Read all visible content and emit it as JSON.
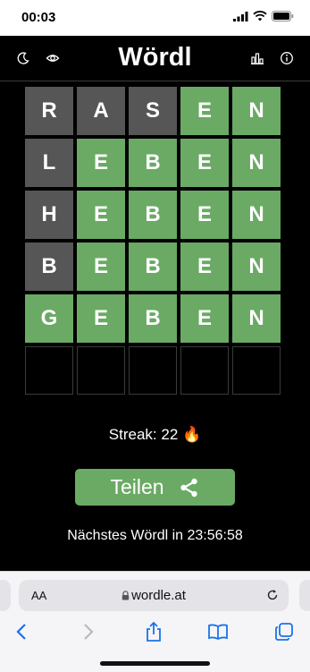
{
  "status_bar": {
    "time": "00:03"
  },
  "header": {
    "title": "Wördl"
  },
  "board": {
    "rows": [
      [
        {
          "letter": "R",
          "state": "absent"
        },
        {
          "letter": "A",
          "state": "absent"
        },
        {
          "letter": "S",
          "state": "absent"
        },
        {
          "letter": "E",
          "state": "correct"
        },
        {
          "letter": "N",
          "state": "correct"
        }
      ],
      [
        {
          "letter": "L",
          "state": "absent"
        },
        {
          "letter": "E",
          "state": "correct"
        },
        {
          "letter": "B",
          "state": "correct"
        },
        {
          "letter": "E",
          "state": "correct"
        },
        {
          "letter": "N",
          "state": "correct"
        }
      ],
      [
        {
          "letter": "H",
          "state": "absent"
        },
        {
          "letter": "E",
          "state": "correct"
        },
        {
          "letter": "B",
          "state": "correct"
        },
        {
          "letter": "E",
          "state": "correct"
        },
        {
          "letter": "N",
          "state": "correct"
        }
      ],
      [
        {
          "letter": "B",
          "state": "absent"
        },
        {
          "letter": "E",
          "state": "correct"
        },
        {
          "letter": "B",
          "state": "correct"
        },
        {
          "letter": "E",
          "state": "correct"
        },
        {
          "letter": "N",
          "state": "correct"
        }
      ],
      [
        {
          "letter": "G",
          "state": "correct"
        },
        {
          "letter": "E",
          "state": "correct"
        },
        {
          "letter": "B",
          "state": "correct"
        },
        {
          "letter": "E",
          "state": "correct"
        },
        {
          "letter": "N",
          "state": "correct"
        }
      ],
      [
        {
          "letter": "",
          "state": "empty"
        },
        {
          "letter": "",
          "state": "empty"
        },
        {
          "letter": "",
          "state": "empty"
        },
        {
          "letter": "",
          "state": "empty"
        },
        {
          "letter": "",
          "state": "empty"
        }
      ]
    ]
  },
  "streak": {
    "label": "Streak: 22 🔥"
  },
  "share": {
    "label": "Teilen"
  },
  "next": {
    "label": "Nächstes Wördl in 23:56:58"
  },
  "browser": {
    "aa_label": "AA",
    "url": "wordle.at"
  },
  "colors": {
    "correct": "#6aaa64",
    "absent": "#565656",
    "background": "#000000",
    "ios_blue": "#1a73e8"
  }
}
